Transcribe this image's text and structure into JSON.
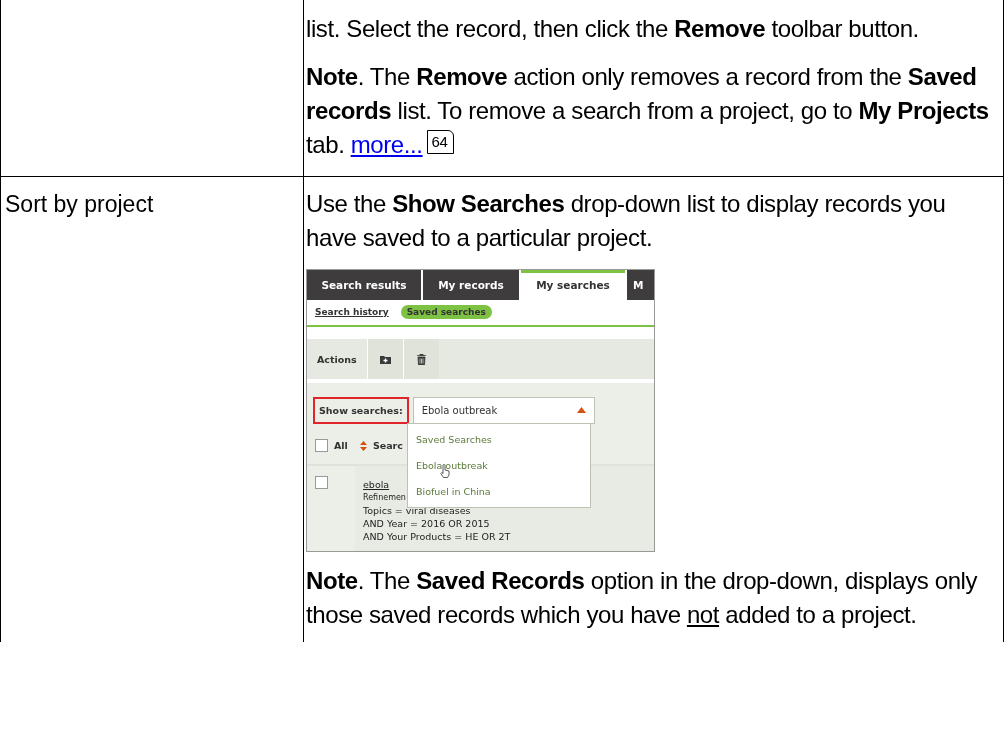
{
  "table": {
    "rows": [
      {
        "content": [
          {
            "kind": "text",
            "segments": [
              {
                "kind": "plain",
                "text": "list. Select the record, then click the **Remove** toolbar button."
              }
            ]
          },
          {
            "kind": "text",
            "segments": [
              {
                "kind": "plain",
                "text": "**Note**. The **Remove** action only removes a record from the **Saved records** list. To remove a search from a project, go to **My Projects** tab. "
              },
              {
                "kind": "link",
                "text": "more..."
              },
              {
                "kind": "page_ref",
                "text": "64"
              }
            ]
          }
        ]
      },
      {
        "label": "Sort by project",
        "content": [
          {
            "kind": "text",
            "segments": [
              {
                "kind": "plain",
                "text": "Use the **Show Searches** drop-down list to display records you have saved to a particular project."
              }
            ]
          },
          {
            "kind": "screenshot",
            "tabs": [
              {
                "label": "Search results",
                "selected": false
              },
              {
                "label": "My records",
                "selected": false
              },
              {
                "label": "My searches",
                "selected": true
              },
              {
                "label": "M",
                "selected": false
              }
            ],
            "subnav": [
              {
                "label": "Search history",
                "selected": false
              },
              {
                "label": "Saved searches",
                "selected": true
              }
            ],
            "actions_label": "Actions",
            "filter": {
              "label": "Show searches:",
              "highlighted": true,
              "value": "Ebola outbreak",
              "expanded": true,
              "options": [
                {
                  "label": "Saved Searches",
                  "hovered": false
                },
                {
                  "label": "Ebola outbreak",
                  "hovered": true
                },
                {
                  "label": "Biofuel in China",
                  "hovered": false
                }
              ]
            },
            "list_header": {
              "select_all": "All",
              "checked": false,
              "sort_column": "Searc"
            },
            "results": [
              {
                "title": "ebola",
                "subtitle": "Refinemen",
                "checked": false,
                "lines": [
                  "Topics = viral diseases",
                  "AND Year = 2016 OR 2015",
                  "AND Your Products = HE OR 2T"
                ]
              }
            ]
          },
          {
            "kind": "text",
            "segments": [
              {
                "kind": "plain",
                "text": "**Note**. The **Saved Records** option in the drop-down, displays only those saved records which you have "
              },
              {
                "kind": "underline",
                "text": "not"
              },
              {
                "kind": "plain",
                "text": " added to a project."
              }
            ]
          }
        ]
      }
    ]
  }
}
